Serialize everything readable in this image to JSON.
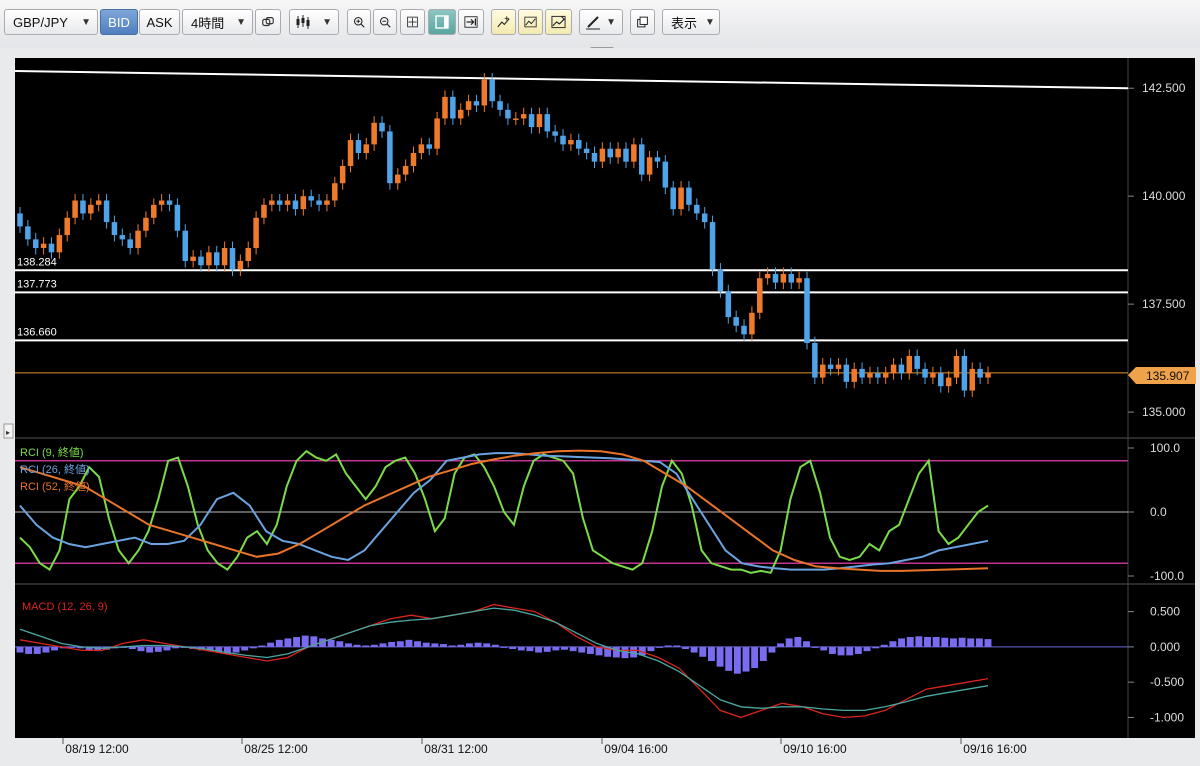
{
  "toolbar": {
    "symbol": "GBP/JPY",
    "bid_label": "BID",
    "ask_label": "ASK",
    "timeframe": "4時間",
    "display_label": "表示"
  },
  "chart_data": {
    "type": "candlestick",
    "title": "",
    "price_axis": {
      "min": 134.4,
      "max": 143.2,
      "ticks": [
        135.0,
        137.5,
        140.0,
        142.5
      ],
      "tick_labels": [
        "135.000",
        "137.500",
        "140.000",
        "142.500"
      ]
    },
    "current_price": "135.907",
    "horizontal_lines": [
      {
        "label": "138.284",
        "value": 138.284
      },
      {
        "label": "137.773",
        "value": 137.773
      },
      {
        "label": "136.660",
        "value": 136.66
      }
    ],
    "trendline": {
      "from": 142.9,
      "to": 142.5
    },
    "x_labels": [
      "08/19 12:00",
      "08/25 12:00",
      "08/31 12:00",
      "09/04 16:00",
      "09/10 16:00",
      "09/16 16:00"
    ],
    "candles": [
      {
        "o": 139.6,
        "c": 139.3
      },
      {
        "o": 139.3,
        "c": 139.0
      },
      {
        "o": 139.0,
        "c": 138.8
      },
      {
        "o": 138.8,
        "c": 138.9
      },
      {
        "o": 138.9,
        "c": 138.7
      },
      {
        "o": 138.7,
        "c": 139.1
      },
      {
        "o": 139.1,
        "c": 139.5
      },
      {
        "o": 139.5,
        "c": 139.9
      },
      {
        "o": 139.9,
        "c": 139.6
      },
      {
        "o": 139.6,
        "c": 139.8
      },
      {
        "o": 139.8,
        "c": 139.9
      },
      {
        "o": 139.9,
        "c": 139.4
      },
      {
        "o": 139.4,
        "c": 139.1
      },
      {
        "o": 139.1,
        "c": 139.0
      },
      {
        "o": 139.0,
        "c": 138.8
      },
      {
        "o": 138.8,
        "c": 139.2
      },
      {
        "o": 139.2,
        "c": 139.5
      },
      {
        "o": 139.5,
        "c": 139.8
      },
      {
        "o": 139.8,
        "c": 139.9
      },
      {
        "o": 139.9,
        "c": 139.8
      },
      {
        "o": 139.8,
        "c": 139.2
      },
      {
        "o": 139.2,
        "c": 138.5
      },
      {
        "o": 138.5,
        "c": 138.6
      },
      {
        "o": 138.6,
        "c": 138.4
      },
      {
        "o": 138.4,
        "c": 138.7
      },
      {
        "o": 138.7,
        "c": 138.4
      },
      {
        "o": 138.4,
        "c": 138.8
      },
      {
        "o": 138.8,
        "c": 138.3
      },
      {
        "o": 138.3,
        "c": 138.5
      },
      {
        "o": 138.5,
        "c": 138.8
      },
      {
        "o": 138.8,
        "c": 139.5
      },
      {
        "o": 139.5,
        "c": 139.8
      },
      {
        "o": 139.8,
        "c": 139.9
      },
      {
        "o": 139.9,
        "c": 139.8
      },
      {
        "o": 139.8,
        "c": 139.9
      },
      {
        "o": 139.9,
        "c": 139.7
      },
      {
        "o": 139.7,
        "c": 140.0
      },
      {
        "o": 140.0,
        "c": 139.9
      },
      {
        "o": 139.9,
        "c": 139.8
      },
      {
        "o": 139.8,
        "c": 139.9
      },
      {
        "o": 139.9,
        "c": 140.3
      },
      {
        "o": 140.3,
        "c": 140.7
      },
      {
        "o": 140.7,
        "c": 141.3
      },
      {
        "o": 141.3,
        "c": 141.0
      },
      {
        "o": 141.0,
        "c": 141.2
      },
      {
        "o": 141.2,
        "c": 141.7
      },
      {
        "o": 141.7,
        "c": 141.5
      },
      {
        "o": 141.5,
        "c": 140.3
      },
      {
        "o": 140.3,
        "c": 140.5
      },
      {
        "o": 140.5,
        "c": 140.7
      },
      {
        "o": 140.7,
        "c": 141.0
      },
      {
        "o": 141.0,
        "c": 141.2
      },
      {
        "o": 141.2,
        "c": 141.1
      },
      {
        "o": 141.1,
        "c": 141.8
      },
      {
        "o": 141.8,
        "c": 142.3
      },
      {
        "o": 142.3,
        "c": 141.8
      },
      {
        "o": 141.8,
        "c": 142.0
      },
      {
        "o": 142.0,
        "c": 142.2
      },
      {
        "o": 142.2,
        "c": 142.1
      },
      {
        "o": 142.1,
        "c": 142.7
      },
      {
        "o": 142.7,
        "c": 142.2
      },
      {
        "o": 142.2,
        "c": 142.0
      },
      {
        "o": 142.0,
        "c": 141.8
      },
      {
        "o": 141.8,
        "c": 141.8
      },
      {
        "o": 141.8,
        "c": 141.9
      },
      {
        "o": 141.9,
        "c": 141.6
      },
      {
        "o": 141.6,
        "c": 141.9
      },
      {
        "o": 141.9,
        "c": 141.5
      },
      {
        "o": 141.5,
        "c": 141.4
      },
      {
        "o": 141.4,
        "c": 141.2
      },
      {
        "o": 141.2,
        "c": 141.3
      },
      {
        "o": 141.3,
        "c": 141.1
      },
      {
        "o": 141.1,
        "c": 141.0
      },
      {
        "o": 141.0,
        "c": 140.8
      },
      {
        "o": 140.8,
        "c": 141.1
      },
      {
        "o": 141.1,
        "c": 140.9
      },
      {
        "o": 140.9,
        "c": 141.1
      },
      {
        "o": 141.1,
        "c": 140.8
      },
      {
        "o": 140.8,
        "c": 141.2
      },
      {
        "o": 141.2,
        "c": 140.5
      },
      {
        "o": 140.5,
        "c": 140.9
      },
      {
        "o": 140.9,
        "c": 140.8
      },
      {
        "o": 140.8,
        "c": 140.2
      },
      {
        "o": 140.2,
        "c": 139.7
      },
      {
        "o": 139.7,
        "c": 140.2
      },
      {
        "o": 140.2,
        "c": 139.8
      },
      {
        "o": 139.8,
        "c": 139.6
      },
      {
        "o": 139.6,
        "c": 139.4
      },
      {
        "o": 139.4,
        "c": 138.3
      },
      {
        "o": 138.3,
        "c": 137.8
      },
      {
        "o": 137.8,
        "c": 137.2
      },
      {
        "o": 137.2,
        "c": 137.0
      },
      {
        "o": 137.0,
        "c": 136.8
      },
      {
        "o": 136.8,
        "c": 137.3
      },
      {
        "o": 137.3,
        "c": 138.1
      },
      {
        "o": 138.1,
        "c": 138.2
      },
      {
        "o": 138.2,
        "c": 138.0
      },
      {
        "o": 138.0,
        "c": 138.2
      },
      {
        "o": 138.2,
        "c": 138.0
      },
      {
        "o": 138.0,
        "c": 138.1
      },
      {
        "o": 138.1,
        "c": 136.6
      },
      {
        "o": 136.6,
        "c": 135.8
      },
      {
        "o": 135.8,
        "c": 136.1
      },
      {
        "o": 136.1,
        "c": 136.0
      },
      {
        "o": 136.0,
        "c": 136.1
      },
      {
        "o": 136.1,
        "c": 135.7
      },
      {
        "o": 135.7,
        "c": 136.0
      },
      {
        "o": 136.0,
        "c": 135.8
      },
      {
        "o": 135.8,
        "c": 135.9
      },
      {
        "o": 135.9,
        "c": 135.8
      },
      {
        "o": 135.8,
        "c": 135.9
      },
      {
        "o": 135.9,
        "c": 136.1
      },
      {
        "o": 136.1,
        "c": 135.9
      },
      {
        "o": 135.9,
        "c": 136.3
      },
      {
        "o": 136.3,
        "c": 136.0
      },
      {
        "o": 136.0,
        "c": 135.8
      },
      {
        "o": 135.8,
        "c": 135.9
      },
      {
        "o": 135.9,
        "c": 135.6
      },
      {
        "o": 135.6,
        "c": 135.8
      },
      {
        "o": 135.8,
        "c": 136.3
      },
      {
        "o": 136.3,
        "c": 135.5
      },
      {
        "o": 135.5,
        "c": 136.0
      },
      {
        "o": 136.0,
        "c": 135.8
      },
      {
        "o": 135.8,
        "c": 135.907
      }
    ],
    "rci": {
      "axis": {
        "min": -100,
        "max": 100,
        "tick_labels": [
          "100.0",
          "0.0",
          "-100.0"
        ],
        "ticks": [
          100,
          0,
          -100
        ]
      },
      "series": [
        {
          "name": "RCI (9, 終値)",
          "color": "#7bdc4a",
          "values": [
            -40,
            -55,
            -80,
            -90,
            -60,
            20,
            40,
            70,
            55,
            -10,
            -60,
            -80,
            -60,
            -30,
            20,
            80,
            85,
            40,
            -20,
            -60,
            -80,
            -90,
            -70,
            -40,
            -30,
            -50,
            -20,
            40,
            80,
            95,
            85,
            80,
            90,
            60,
            40,
            20,
            40,
            70,
            80,
            85,
            60,
            20,
            -30,
            -10,
            60,
            85,
            90,
            70,
            40,
            0,
            -20,
            40,
            80,
            90,
            85,
            80,
            60,
            -10,
            -60,
            -70,
            -80,
            -85,
            -90,
            -80,
            -30,
            40,
            80,
            60,
            10,
            -60,
            -80,
            -85,
            -90,
            -90,
            -95,
            -92,
            -95,
            -60,
            20,
            70,
            80,
            30,
            -40,
            -70,
            -75,
            -70,
            -50,
            -60,
            -30,
            -20,
            20,
            60,
            80,
            -30,
            -50,
            -40,
            -20,
            0,
            10
          ]
        },
        {
          "name": "RCI (26, 終値)",
          "color": "#6aa3e0",
          "values": [
            10,
            -20,
            -40,
            -50,
            -55,
            -50,
            -45,
            -40,
            -50,
            -50,
            -45,
            -20,
            20,
            30,
            10,
            -30,
            -45,
            -50,
            -60,
            -70,
            -75,
            -60,
            -30,
            0,
            30,
            50,
            80,
            85,
            90,
            92,
            92,
            90,
            88,
            87,
            86,
            85,
            84,
            82,
            80,
            78,
            60,
            20,
            -20,
            -60,
            -80,
            -85,
            -88,
            -90,
            -90,
            -90,
            -88,
            -85,
            -82,
            -80,
            -75,
            -70,
            -60,
            -55,
            -50,
            -45
          ]
        },
        {
          "name": "RCI (52, 終値)",
          "color": "#e8742a",
          "values": [
            70,
            60,
            50,
            40,
            20,
            0,
            -20,
            -30,
            -40,
            -50,
            -60,
            -70,
            -65,
            -50,
            -30,
            -10,
            10,
            25,
            40,
            55,
            65,
            75,
            82,
            88,
            92,
            95,
            96,
            95,
            90,
            80,
            60,
            40,
            15,
            -10,
            -35,
            -60,
            -75,
            -85,
            -88,
            -90,
            -92,
            -92,
            -91,
            -90,
            -89,
            -88
          ]
        }
      ]
    },
    "macd": {
      "name": "MACD (12, 26, 9)",
      "axis": {
        "min": -1.15,
        "max": 0.75,
        "tick_labels": [
          "0.500",
          "0.000",
          "-0.500",
          "-1.000"
        ],
        "ticks": [
          0.5,
          0.0,
          -0.5,
          -1.0
        ]
      },
      "macd_line": {
        "color": "#d9261c",
        "values": [
          0.1,
          0.05,
          0.0,
          -0.05,
          -0.05,
          0.05,
          0.1,
          0.05,
          0.0,
          -0.05,
          -0.1,
          -0.15,
          -0.2,
          -0.15,
          0.0,
          0.1,
          0.2,
          0.3,
          0.4,
          0.45,
          0.4,
          0.45,
          0.5,
          0.6,
          0.55,
          0.5,
          0.35,
          0.15,
          0.0,
          -0.05,
          -0.05,
          -0.15,
          -0.3,
          -0.6,
          -0.9,
          -1.0,
          -0.9,
          -0.8,
          -0.85,
          -0.95,
          -1.0,
          -0.98,
          -0.9,
          -0.75,
          -0.6,
          -0.55,
          -0.5,
          -0.45
        ]
      },
      "signal_line": {
        "color": "#4aa8a0",
        "values": [
          0.25,
          0.15,
          0.05,
          0.0,
          -0.02,
          0.0,
          0.02,
          0.02,
          0.0,
          -0.03,
          -0.08,
          -0.12,
          -0.15,
          -0.1,
          0.0,
          0.1,
          0.2,
          0.3,
          0.35,
          0.38,
          0.4,
          0.45,
          0.5,
          0.55,
          0.52,
          0.45,
          0.35,
          0.2,
          0.05,
          -0.05,
          -0.1,
          -0.2,
          -0.35,
          -0.55,
          -0.75,
          -0.85,
          -0.87,
          -0.85,
          -0.85,
          -0.88,
          -0.9,
          -0.9,
          -0.85,
          -0.78,
          -0.7,
          -0.65,
          -0.6,
          -0.55
        ]
      },
      "histogram": {
        "color": "#7a6cf0",
        "values": [
          -0.08,
          -0.1,
          -0.1,
          -0.08,
          -0.05,
          -0.02,
          0.0,
          -0.02,
          -0.05,
          -0.06,
          -0.04,
          -0.02,
          0.0,
          -0.03,
          -0.06,
          -0.08,
          -0.07,
          -0.05,
          -0.02,
          0.0,
          -0.03,
          -0.05,
          -0.06,
          -0.08,
          -0.1,
          -0.08,
          -0.05,
          -0.02,
          0.02,
          0.06,
          0.1,
          0.12,
          0.14,
          0.16,
          0.15,
          0.12,
          0.1,
          0.08,
          0.05,
          0.03,
          0.02,
          0.03,
          0.05,
          0.07,
          0.08,
          0.1,
          0.08,
          0.06,
          0.05,
          0.04,
          0.02,
          0.03,
          0.05,
          0.06,
          0.05,
          0.03,
          0.0,
          -0.03,
          -0.05,
          -0.06,
          -0.08,
          -0.07,
          -0.05,
          -0.04,
          -0.06,
          -0.08,
          -0.1,
          -0.12,
          -0.14,
          -0.15,
          -0.16,
          -0.15,
          -0.12,
          -0.06,
          0.0,
          0.02,
          0.02,
          -0.03,
          -0.08,
          -0.14,
          -0.2,
          -0.28,
          -0.34,
          -0.38,
          -0.35,
          -0.3,
          -0.2,
          -0.08,
          0.05,
          0.12,
          0.14,
          0.08,
          0.0,
          -0.05,
          -0.1,
          -0.12,
          -0.12,
          -0.1,
          -0.06,
          -0.02,
          0.03,
          0.08,
          0.12,
          0.14,
          0.15,
          0.14,
          0.14,
          0.13,
          0.12,
          0.13,
          0.12,
          0.12,
          0.11
        ]
      }
    }
  }
}
